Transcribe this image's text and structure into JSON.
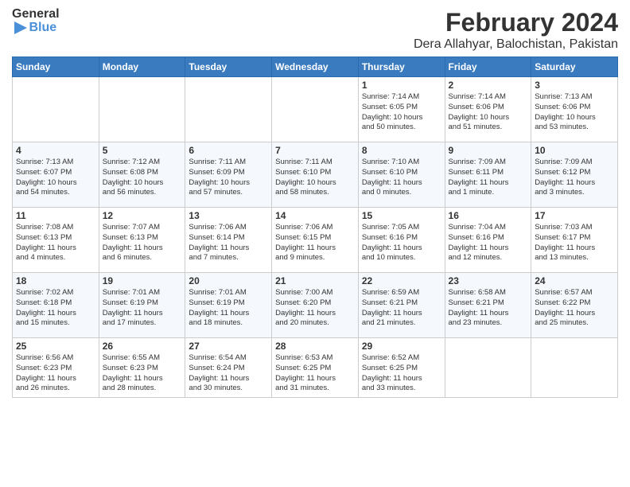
{
  "header": {
    "logo_line1": "General",
    "logo_line2": "Blue",
    "title": "February 2024",
    "subtitle": "Dera Allahyar, Balochistan, Pakistan"
  },
  "days_of_week": [
    "Sunday",
    "Monday",
    "Tuesday",
    "Wednesday",
    "Thursday",
    "Friday",
    "Saturday"
  ],
  "weeks": [
    [
      {
        "day": "",
        "info": ""
      },
      {
        "day": "",
        "info": ""
      },
      {
        "day": "",
        "info": ""
      },
      {
        "day": "",
        "info": ""
      },
      {
        "day": "1",
        "info": "Sunrise: 7:14 AM\nSunset: 6:05 PM\nDaylight: 10 hours\nand 50 minutes."
      },
      {
        "day": "2",
        "info": "Sunrise: 7:14 AM\nSunset: 6:06 PM\nDaylight: 10 hours\nand 51 minutes."
      },
      {
        "day": "3",
        "info": "Sunrise: 7:13 AM\nSunset: 6:06 PM\nDaylight: 10 hours\nand 53 minutes."
      }
    ],
    [
      {
        "day": "4",
        "info": "Sunrise: 7:13 AM\nSunset: 6:07 PM\nDaylight: 10 hours\nand 54 minutes."
      },
      {
        "day": "5",
        "info": "Sunrise: 7:12 AM\nSunset: 6:08 PM\nDaylight: 10 hours\nand 56 minutes."
      },
      {
        "day": "6",
        "info": "Sunrise: 7:11 AM\nSunset: 6:09 PM\nDaylight: 10 hours\nand 57 minutes."
      },
      {
        "day": "7",
        "info": "Sunrise: 7:11 AM\nSunset: 6:10 PM\nDaylight: 10 hours\nand 58 minutes."
      },
      {
        "day": "8",
        "info": "Sunrise: 7:10 AM\nSunset: 6:10 PM\nDaylight: 11 hours\nand 0 minutes."
      },
      {
        "day": "9",
        "info": "Sunrise: 7:09 AM\nSunset: 6:11 PM\nDaylight: 11 hours\nand 1 minute."
      },
      {
        "day": "10",
        "info": "Sunrise: 7:09 AM\nSunset: 6:12 PM\nDaylight: 11 hours\nand 3 minutes."
      }
    ],
    [
      {
        "day": "11",
        "info": "Sunrise: 7:08 AM\nSunset: 6:13 PM\nDaylight: 11 hours\nand 4 minutes."
      },
      {
        "day": "12",
        "info": "Sunrise: 7:07 AM\nSunset: 6:13 PM\nDaylight: 11 hours\nand 6 minutes."
      },
      {
        "day": "13",
        "info": "Sunrise: 7:06 AM\nSunset: 6:14 PM\nDaylight: 11 hours\nand 7 minutes."
      },
      {
        "day": "14",
        "info": "Sunrise: 7:06 AM\nSunset: 6:15 PM\nDaylight: 11 hours\nand 9 minutes."
      },
      {
        "day": "15",
        "info": "Sunrise: 7:05 AM\nSunset: 6:16 PM\nDaylight: 11 hours\nand 10 minutes."
      },
      {
        "day": "16",
        "info": "Sunrise: 7:04 AM\nSunset: 6:16 PM\nDaylight: 11 hours\nand 12 minutes."
      },
      {
        "day": "17",
        "info": "Sunrise: 7:03 AM\nSunset: 6:17 PM\nDaylight: 11 hours\nand 13 minutes."
      }
    ],
    [
      {
        "day": "18",
        "info": "Sunrise: 7:02 AM\nSunset: 6:18 PM\nDaylight: 11 hours\nand 15 minutes."
      },
      {
        "day": "19",
        "info": "Sunrise: 7:01 AM\nSunset: 6:19 PM\nDaylight: 11 hours\nand 17 minutes."
      },
      {
        "day": "20",
        "info": "Sunrise: 7:01 AM\nSunset: 6:19 PM\nDaylight: 11 hours\nand 18 minutes."
      },
      {
        "day": "21",
        "info": "Sunrise: 7:00 AM\nSunset: 6:20 PM\nDaylight: 11 hours\nand 20 minutes."
      },
      {
        "day": "22",
        "info": "Sunrise: 6:59 AM\nSunset: 6:21 PM\nDaylight: 11 hours\nand 21 minutes."
      },
      {
        "day": "23",
        "info": "Sunrise: 6:58 AM\nSunset: 6:21 PM\nDaylight: 11 hours\nand 23 minutes."
      },
      {
        "day": "24",
        "info": "Sunrise: 6:57 AM\nSunset: 6:22 PM\nDaylight: 11 hours\nand 25 minutes."
      }
    ],
    [
      {
        "day": "25",
        "info": "Sunrise: 6:56 AM\nSunset: 6:23 PM\nDaylight: 11 hours\nand 26 minutes."
      },
      {
        "day": "26",
        "info": "Sunrise: 6:55 AM\nSunset: 6:23 PM\nDaylight: 11 hours\nand 28 minutes."
      },
      {
        "day": "27",
        "info": "Sunrise: 6:54 AM\nSunset: 6:24 PM\nDaylight: 11 hours\nand 30 minutes."
      },
      {
        "day": "28",
        "info": "Sunrise: 6:53 AM\nSunset: 6:25 PM\nDaylight: 11 hours\nand 31 minutes."
      },
      {
        "day": "29",
        "info": "Sunrise: 6:52 AM\nSunset: 6:25 PM\nDaylight: 11 hours\nand 33 minutes."
      },
      {
        "day": "",
        "info": ""
      },
      {
        "day": "",
        "info": ""
      }
    ]
  ]
}
